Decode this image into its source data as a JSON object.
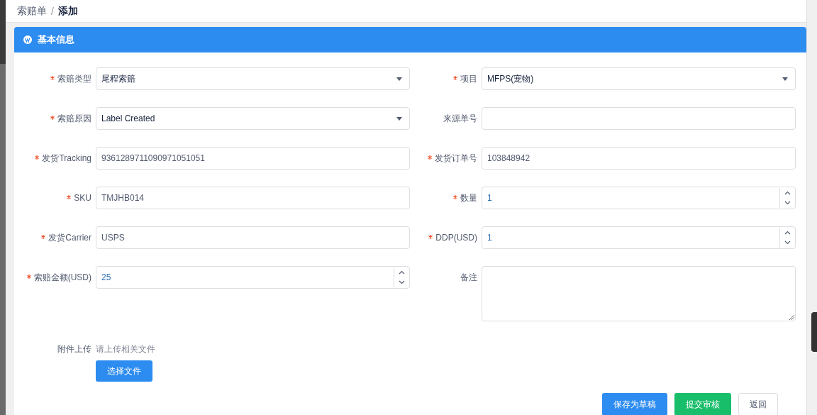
{
  "breadcrumb": {
    "items": [
      {
        "label": "索赔单",
        "current": false
      },
      {
        "label": "添加",
        "current": true
      }
    ],
    "separator": "/"
  },
  "panel": {
    "title": "基本信息",
    "fields": [
      {
        "label": "索赔类型",
        "required": true,
        "kind": "select",
        "value": "尾程索赔"
      },
      {
        "label": "项目",
        "required": true,
        "kind": "select",
        "value": "MFPS(宠物)"
      },
      {
        "label": "索赔原因",
        "required": true,
        "kind": "select",
        "value": "Label Created"
      },
      {
        "label": "来源单号",
        "required": false,
        "kind": "text"
      },
      {
        "label": "发货Tracking",
        "required": true,
        "kind": "text",
        "value": "9361289711090971051051"
      },
      {
        "label": "发货订单号",
        "required": true,
        "kind": "text",
        "value": "103848942"
      },
      {
        "label": "SKU",
        "required": true,
        "kind": "text",
        "value": "TMJHB014"
      },
      {
        "label": "数量",
        "required": true,
        "kind": "number",
        "value": "1"
      },
      {
        "label": "发货Carrier",
        "required": true,
        "kind": "text",
        "value": "USPS"
      },
      {
        "label": "DDP(USD)",
        "required": true,
        "kind": "number",
        "value": "1"
      },
      {
        "label": "索赔金额(USD)",
        "required": true,
        "kind": "number",
        "value": "25"
      },
      {
        "label": "备注",
        "required": false,
        "kind": "textarea"
      }
    ],
    "upload": {
      "label": "附件上传",
      "hint": "请上传相关文件",
      "button": "选择文件"
    }
  },
  "actions": [
    {
      "label": "保存为草稿",
      "kind": "primary"
    },
    {
      "label": "提交审核",
      "kind": "success"
    },
    {
      "label": "返回",
      "kind": "default"
    }
  ]
}
